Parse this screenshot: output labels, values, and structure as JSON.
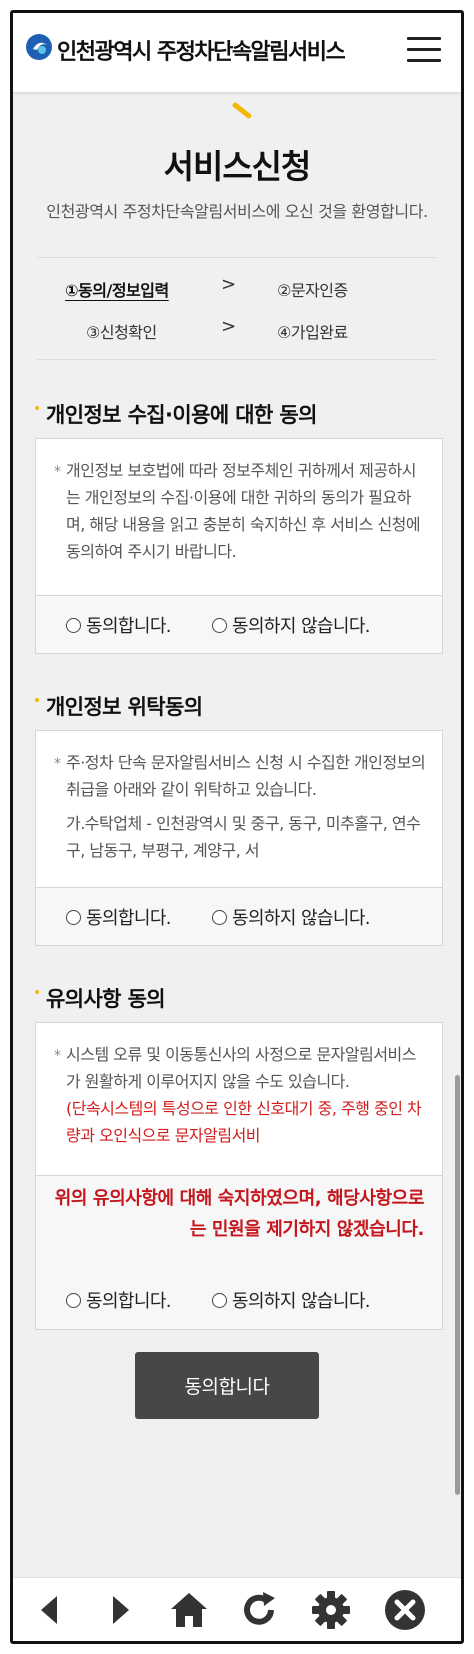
{
  "header": {
    "app_title": "인천광역시 주정차단속알림서비스",
    "logo_icon": "incheon-logo-icon",
    "menu_icon": "hamburger-menu-icon"
  },
  "page": {
    "title": "서비스신청",
    "welcome": "인천광역시 주정차단속알림서비스에 오신 것을 환영합니다."
  },
  "steps": [
    {
      "label": "①동의/정보입력",
      "active": true
    },
    {
      "label": "②문자인증",
      "active": false
    },
    {
      "label": "③신청확인",
      "active": false
    },
    {
      "label": "④가입완료",
      "active": false
    }
  ],
  "step_arrow": ">",
  "sections": [
    {
      "title": "개인정보 수집·이용에 대한 동의",
      "bullet": "*",
      "paragraphs": [
        "개인정보 보호법에 따라 정보주체인 귀하께서 제공하시는 개인정보의 수집·이용에 대한 귀하의 동의가 필요하며, 해당 내용을 읽고 충분히 숙지하신 후 서비스 신청에 동의하여 주시기 바랍니다."
      ],
      "agree_label": "동의합니다.",
      "disagree_label": "동의하지 않습니다."
    },
    {
      "title": "개인정보 위탁동의",
      "bullet": "*",
      "paragraphs": [
        "주·정차 단속 문자알림서비스 신청 시 수집한 개인정보의 취급을 아래와 같이 위탁하고 있습니다.",
        "가.수탁업체 - 인천광역시 및 중구, 동구, 미추홀구, 연수구, 남동구, 부평구, 계양구, 서"
      ],
      "agree_label": "동의합니다.",
      "disagree_label": "동의하지 않습니다."
    },
    {
      "title": "유의사항 동의",
      "bullet": "*",
      "paragraphs": [
        "시스템 오류 및 이동통신사의 사정으로 문자알림서비스가 원활하게 이루어지지 않을 수도 있습니다."
      ],
      "red_text": "(단속시스템의 특성으로 인한 신호대기 중, 주행 중인 차량과 오인식으로 문자알림서비",
      "notice": "위의 유의사항에 대해 숙지하였으며, 해당사항으로는 민원을 제기하지 않겠습니다.",
      "agree_label": "동의합니다.",
      "disagree_label": "동의하지 않습니다."
    }
  ],
  "submit_label": "동의합니다",
  "bottom_nav": [
    "back-arrow-icon",
    "forward-arrow-icon",
    "home-icon",
    "refresh-icon",
    "settings-gear-icon",
    "close-icon"
  ],
  "colors": {
    "accent_yellow": "#f3b800",
    "notice_red": "#c4161c",
    "button_dark": "#474747",
    "logo_blue": "#1f5fb3"
  }
}
